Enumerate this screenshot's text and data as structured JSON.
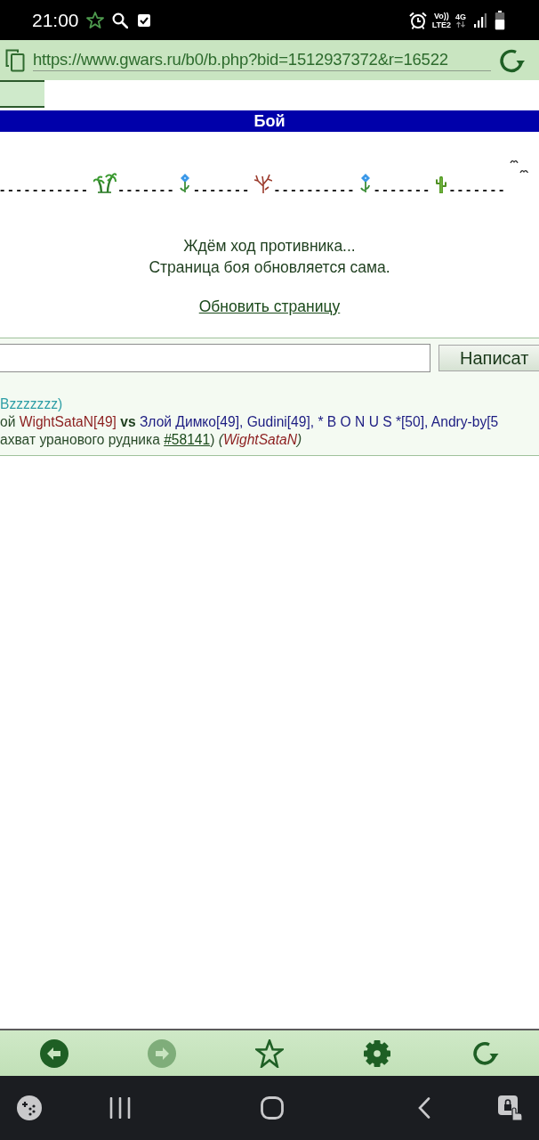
{
  "status_bar": {
    "time": "21:00",
    "volte": "Vo))",
    "lte": "LTE2",
    "network": "4G"
  },
  "address_bar": {
    "url": "https://www.gwars.ru/b0/b.php?bid=1512937372&r=16522"
  },
  "title_bar": {
    "title": "Бой"
  },
  "battlefield": {
    "segments": [
      {
        "dashes": "-----------",
        "kind": "palm"
      },
      {
        "dashes": "-------",
        "kind": "flower"
      },
      {
        "dashes": "-------",
        "kind": "bush"
      },
      {
        "dashes": "----------",
        "kind": "flower"
      },
      {
        "dashes": "-------",
        "kind": "cactus"
      },
      {
        "dashes": "-------",
        "kind": "birds"
      }
    ]
  },
  "status_message": {
    "lines": [
      "Ждём ход противника...",
      "Страница боя обновляется сама."
    ],
    "refresh_link": "Обновить страницу"
  },
  "chat": {
    "button": "Написат"
  },
  "log": [
    {
      "segments": [
        {
          "kind": "system",
          "text": "Bzzzzzzz)"
        }
      ]
    },
    {
      "segments": [
        {
          "kind": "plain",
          "text": "ой "
        },
        {
          "kind": "attacker",
          "text": "WightSataN[49]"
        },
        {
          "kind": "versus",
          "text": " vs "
        },
        {
          "kind": "defender",
          "text": "Злой Димко[49], Gudini[49], * B O N U S *[50], Andry-by[5"
        }
      ]
    },
    {
      "segments": [
        {
          "kind": "plain",
          "text": "ахват уранового рудника "
        },
        {
          "kind": "link",
          "text": "#58141"
        },
        {
          "kind": "plain",
          "text": ") "
        },
        {
          "kind": "aside",
          "text": "("
        },
        {
          "kind": "author",
          "text": "WightSataN"
        },
        {
          "kind": "aside",
          "text": ")"
        }
      ]
    }
  ],
  "toolbar": {
    "buttons": [
      {
        "kind": "back",
        "disabled": false
      },
      {
        "kind": "forward",
        "disabled": true
      },
      {
        "kind": "bookmark",
        "disabled": false
      },
      {
        "kind": "settings",
        "disabled": false
      },
      {
        "kind": "reload",
        "disabled": false
      }
    ]
  }
}
